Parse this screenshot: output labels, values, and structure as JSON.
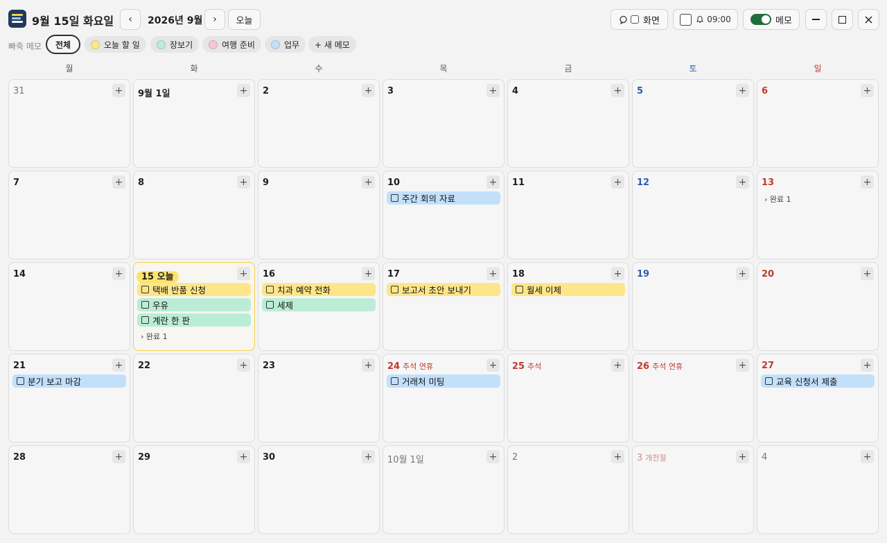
{
  "header": {
    "title": "9월 15일 화요일",
    "month": "2026년 9월",
    "today_label": "오늘",
    "screen_label": "화면",
    "alarm_time": "09:00",
    "memo_toggle_label": "메모"
  },
  "filters": {
    "label": "빠죽 메모",
    "chips": [
      {
        "label": "전체",
        "color": null
      },
      {
        "label": "오늘 할 일",
        "color": "#fde68a"
      },
      {
        "label": "장보기",
        "color": "#bbedd6"
      },
      {
        "label": "여행 준비",
        "color": "#f8c6d4"
      },
      {
        "label": "업무",
        "color": "#c3e0fb"
      }
    ],
    "new_memo_label": "+ 새 메모"
  },
  "weekdays": [
    "월",
    "화",
    "수",
    "목",
    "금",
    "토",
    "일"
  ],
  "colors": {
    "today_border": "#f2cf4a",
    "saturday": "#2a5db0",
    "sunday": "#c0392b",
    "memo_yellow": "#fde68a",
    "memo_green": "#bbedd6",
    "memo_blue": "#c3e0fb"
  },
  "add_symbol": "+",
  "weeks": [
    [
      {
        "label": "31",
        "kind": "muted"
      },
      {
        "label": "9월 1일",
        "kind": "normal"
      },
      {
        "label": "2",
        "kind": "normal"
      },
      {
        "label": "3",
        "kind": "normal"
      },
      {
        "label": "4",
        "kind": "normal"
      },
      {
        "label": "5",
        "kind": "sat"
      },
      {
        "label": "6",
        "kind": "sun"
      }
    ],
    [
      {
        "label": "7",
        "kind": "normal"
      },
      {
        "label": "8",
        "kind": "normal"
      },
      {
        "label": "9",
        "kind": "normal"
      },
      {
        "label": "10",
        "kind": "normal",
        "memos": [
          {
            "text": "주간 회의 자료",
            "color": "blue"
          }
        ]
      },
      {
        "label": "11",
        "kind": "normal"
      },
      {
        "label": "12",
        "kind": "sat"
      },
      {
        "label": "13",
        "kind": "sun",
        "done": "완료 1"
      }
    ],
    [
      {
        "label": "14",
        "kind": "normal"
      },
      {
        "label": "15 오늘",
        "kind": "today",
        "memos": [
          {
            "text": "택배 반품 신청",
            "color": "yellow"
          },
          {
            "text": "우유",
            "color": "green"
          },
          {
            "text": "계란 한 판",
            "color": "green"
          }
        ],
        "done": "완료 1"
      },
      {
        "label": "16",
        "kind": "normal",
        "memos": [
          {
            "text": "치과 예약 전화",
            "color": "yellow"
          },
          {
            "text": "세제",
            "color": "green"
          }
        ]
      },
      {
        "label": "17",
        "kind": "normal",
        "memos": [
          {
            "text": "보고서 초안 보내기",
            "color": "yellow"
          }
        ]
      },
      {
        "label": "18",
        "kind": "normal",
        "memos": [
          {
            "text": "월세 이체",
            "color": "yellow"
          }
        ]
      },
      {
        "label": "19",
        "kind": "sat"
      },
      {
        "label": "20",
        "kind": "sun"
      }
    ],
    [
      {
        "label": "21",
        "kind": "normal",
        "memos": [
          {
            "text": "분기 보고 마감",
            "color": "blue"
          }
        ]
      },
      {
        "label": "22",
        "kind": "normal"
      },
      {
        "label": "23",
        "kind": "normal"
      },
      {
        "label": "24",
        "kind": "holiday",
        "holiday": "추석 연휴",
        "memos": [
          {
            "text": "거래처 미팅",
            "color": "blue"
          }
        ]
      },
      {
        "label": "25",
        "kind": "holiday",
        "holiday": "추석"
      },
      {
        "label": "26",
        "kind": "holiday",
        "holiday": "추석 연휴"
      },
      {
        "label": "27",
        "kind": "sun",
        "memos": [
          {
            "text": "교육 신청서 제출",
            "color": "blue"
          }
        ]
      }
    ],
    [
      {
        "label": "28",
        "kind": "normal"
      },
      {
        "label": "29",
        "kind": "normal"
      },
      {
        "label": "30",
        "kind": "normal"
      },
      {
        "label": "10월 1일",
        "kind": "muted"
      },
      {
        "label": "2",
        "kind": "muted"
      },
      {
        "label": "3",
        "kind": "faded",
        "holiday": "개천절"
      },
      {
        "label": "4",
        "kind": "muted"
      }
    ]
  ]
}
